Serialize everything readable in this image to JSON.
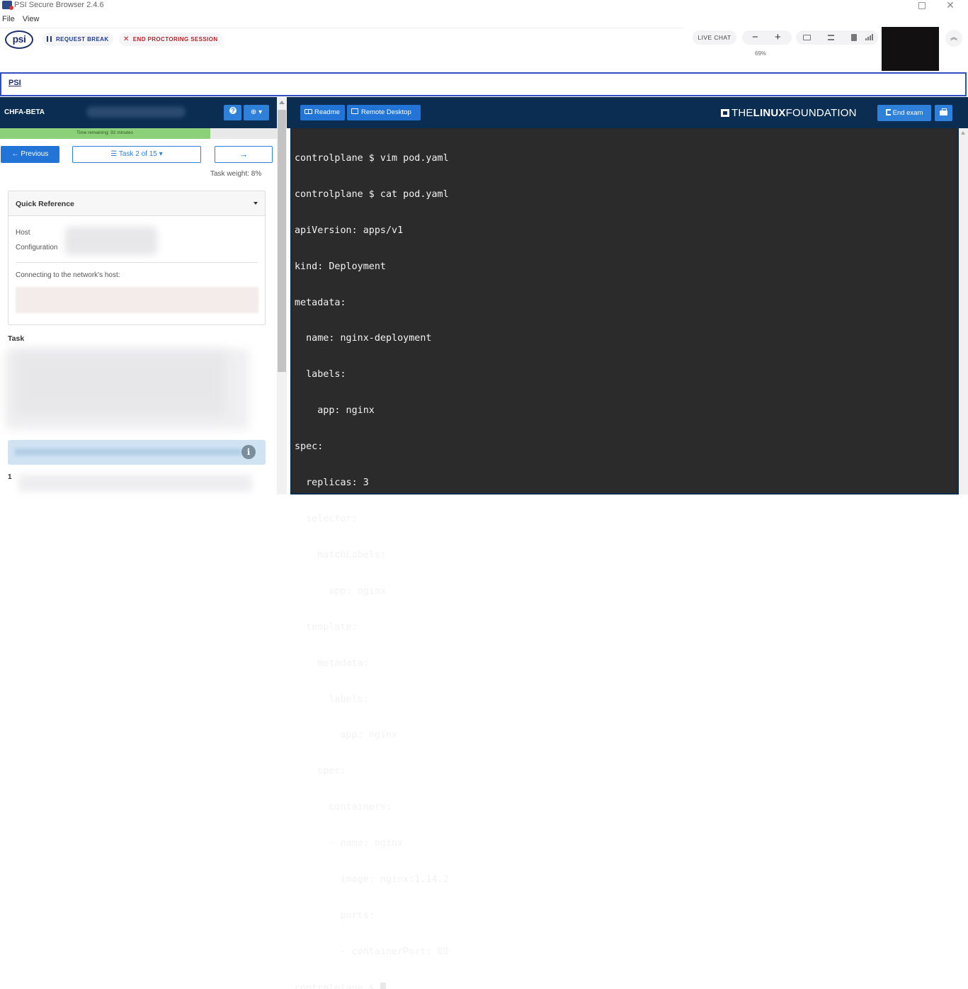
{
  "window": {
    "title": "PSI Secure Browser 2.4.6"
  },
  "menu": [
    "File",
    "View"
  ],
  "toolbar": {
    "logo_text": "psi",
    "request_break": "REQUEST BREAK",
    "end_session": "END PROCTORING SESSION",
    "live_chat": "LIVE CHAT",
    "zoom_minus": "−",
    "zoom_plus": "+",
    "zoom_level": "69%"
  },
  "tabs": [
    "PSI"
  ],
  "exam_panel": {
    "title": "CHFA-BETA",
    "time_remaining": "Time remaining: 92 minutes",
    "time_fraction": 0.76,
    "previous": "← Previous",
    "task_selector": "☰ Task 2 of 15 ▾",
    "next": "→",
    "task_weight": "Task weight: 8%",
    "quick_reference": {
      "title": "Quick Reference",
      "host_label": "Host",
      "configuration_label": "Configuration",
      "connecting_label": "Connecting to the network's host:"
    },
    "task_label": "Task",
    "step_number": "1"
  },
  "workspace": {
    "readme": "Readme",
    "remote_desktop": "Remote Desktop",
    "brand_the": "THE",
    "brand_linux": "LINUX",
    "brand_foundation": "FOUNDATION",
    "end_exam": "End exam"
  },
  "terminal": {
    "lines": [
      "controlplane $ vim pod.yaml",
      "controlplane $ cat pod.yaml",
      "apiVersion: apps/v1",
      "kind: Deployment",
      "metadata:",
      "  name: nginx-deployment",
      "  labels:",
      "    app: nginx",
      "spec:",
      "  replicas: 3",
      "  selector:",
      "    matchLabels:",
      "      app: nginx",
      "  template:",
      "    metadata:",
      "      labels:",
      "        app: nginx",
      "    spec:",
      "      containers:",
      "      - name: nginx",
      "        image: nginx:1.14.2",
      "        ports:",
      "        - containerPort: 80"
    ],
    "prompt": "controlplane $ "
  },
  "colors": {
    "header_navy": "#0b2d52",
    "accent_blue": "#2275d6",
    "time_green": "#8dd07a",
    "terminal_bg": "#2b2b2b"
  }
}
